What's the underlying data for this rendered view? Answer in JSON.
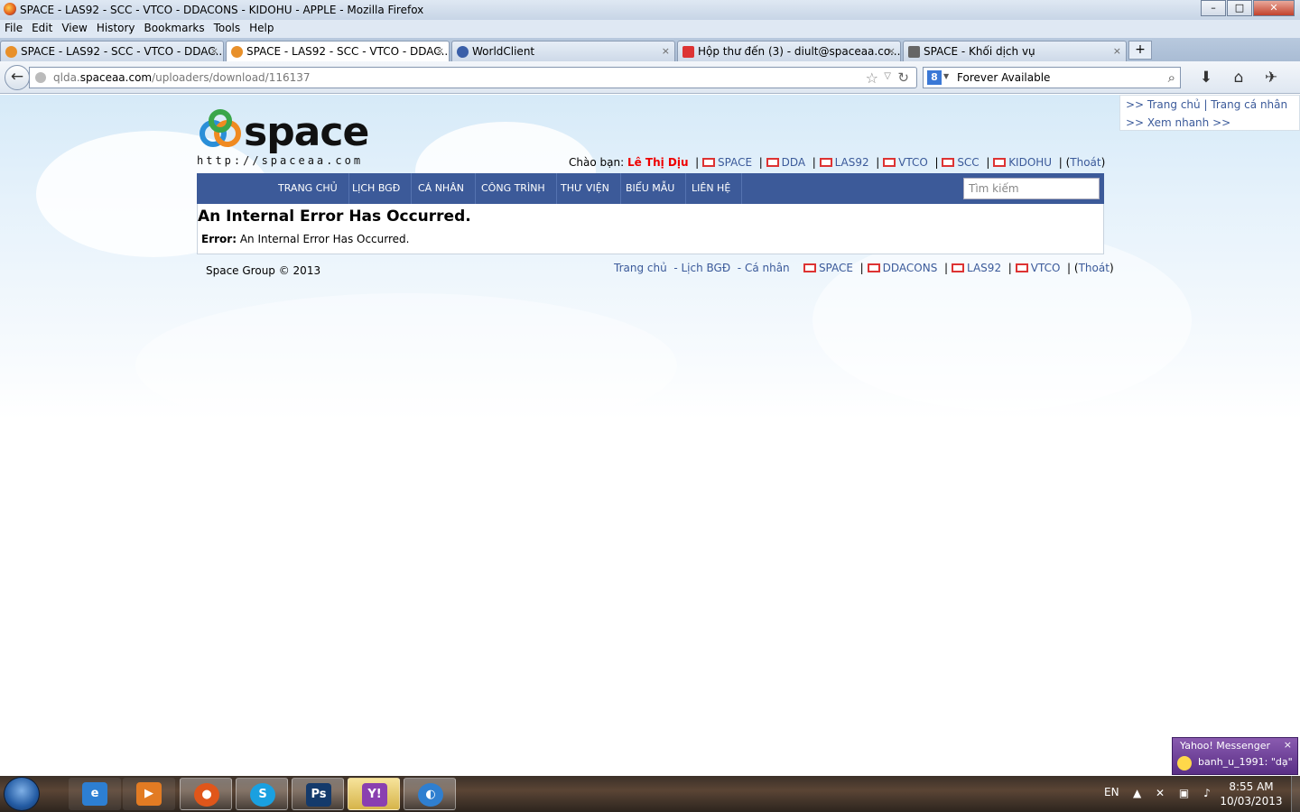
{
  "window": {
    "title": "SPACE - LAS92 - SCC - VTCO - DDACONS - KIDOHU - APPLE - Mozilla Firefox",
    "minimize": "–",
    "maximize": "□",
    "close": "✕"
  },
  "menu": [
    "File",
    "Edit",
    "View",
    "History",
    "Bookmarks",
    "Tools",
    "Help"
  ],
  "tabs": [
    {
      "label": "SPACE - LAS92 - SCC - VTCO - DDAC...",
      "icon": "space-icon",
      "color": "#e8902a"
    },
    {
      "label": "SPACE - LAS92 - SCC - VTCO - DDAC...",
      "icon": "space-icon",
      "color": "#e8902a"
    },
    {
      "label": "WorldClient",
      "icon": "globe-icon",
      "color": "#3a5fa8"
    },
    {
      "label": "Hộp thư đến (3) - diult@spaceaa.co...",
      "icon": "gmail-icon",
      "color": "#d33"
    },
    {
      "label": "SPACE - Khối dịch vụ",
      "icon": "page-icon",
      "color": "#666"
    }
  ],
  "tab_close": "×",
  "new_tab": "+",
  "nav": {
    "back": "←",
    "url_prefix": "qlda.",
    "url_domain": "spaceaa.com",
    "url_path": "/uploaders/download/116137",
    "star": "☆",
    "dropdown": "▽",
    "reload": "↻",
    "search_engine": "8",
    "search_dropdown": "▼",
    "search_text": "Forever Available",
    "search_glass": "⌕",
    "download": "⬇",
    "home": "⌂",
    "addon": "✈"
  },
  "side_panel": {
    "line1": ">> Trang chủ |   Trang cá nhân",
    "line2": "  >> Xem nhanh >>"
  },
  "logo": {
    "word": "space",
    "url": "http://spaceaa.com"
  },
  "greeting": {
    "prefix": "Chào bạn: ",
    "user": "Lê Thị Dịu",
    "links": [
      "SPACE",
      "DDA",
      "LAS92",
      "VTCO",
      "SCC",
      "KIDOHU"
    ],
    "logout_open": "(",
    "logout": "Thoát",
    "logout_close": ")"
  },
  "main_menu": [
    "TRANG CHỦ",
    "LỊCH BGĐ",
    "CÁ NHÂN",
    "CÔNG TRÌNH",
    "THƯ VIỆN",
    "BIỂU MẪU",
    "LIÊN HỆ"
  ],
  "search_placeholder": "Tìm kiếm",
  "error": {
    "heading": "An Internal Error Has Occurred.",
    "label": "Error:",
    "message": " An Internal Error Has Occurred."
  },
  "footer": {
    "copyright": "Space Group © 2013",
    "text_links": [
      "Trang chủ",
      "- Lịch BGĐ",
      "- Cá nhân"
    ],
    "mail_links": [
      "SPACE",
      "DDACONS",
      "LAS92",
      "VTCO"
    ],
    "logout": "Thoát"
  },
  "yahoo": {
    "title": "Yahoo! Messenger",
    "close": "×",
    "message": "banh_u_1991:  \"dạ\""
  },
  "taskbar": {
    "apps": [
      {
        "name": "ie-icon",
        "glyph": "e",
        "color": "#2d7fd3"
      },
      {
        "name": "media-player-icon",
        "glyph": "▶",
        "color": "#e27b23"
      },
      {
        "name": "firefox-icon",
        "glyph": "●",
        "color": "#e0561a"
      },
      {
        "name": "skype-icon",
        "glyph": "S",
        "color": "#1aa0e0"
      },
      {
        "name": "photoshop-icon",
        "glyph": "Ps",
        "color": "#143a6b"
      },
      {
        "name": "yahoo-messenger-icon",
        "glyph": "Y!",
        "color": "#8a3fb0"
      },
      {
        "name": "app-icon",
        "glyph": "◐",
        "color": "#2f7fd0"
      }
    ],
    "lang": "EN",
    "tray_icons": "▲ ✕ ▣ ♪",
    "time": "8:55 AM",
    "date": "10/03/2013"
  }
}
